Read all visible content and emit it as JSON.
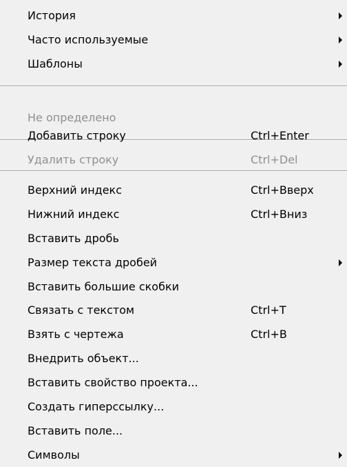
{
  "menu": {
    "items": [
      {
        "label": "История",
        "shortcut": "",
        "submenu": true,
        "disabled": false
      },
      {
        "label": "Часто используемые",
        "shortcut": "",
        "submenu": true,
        "disabled": false
      },
      {
        "label": "Шаблоны",
        "shortcut": "",
        "submenu": true,
        "disabled": false
      },
      {
        "label": "Не определено",
        "shortcut": "",
        "submenu": false,
        "disabled": true
      },
      {
        "label": "Добавить строку",
        "shortcut": "Ctrl+Enter",
        "submenu": false,
        "disabled": false
      },
      {
        "label": "Удалить строку",
        "shortcut": "Ctrl+Del",
        "submenu": false,
        "disabled": true
      },
      {
        "label": "Верхний индекс",
        "shortcut": "Ctrl+Вверх",
        "submenu": false,
        "disabled": false
      },
      {
        "label": "Нижний индекс",
        "shortcut": "Ctrl+Вниз",
        "submenu": false,
        "disabled": false
      },
      {
        "label": "Вставить дробь",
        "shortcut": "",
        "submenu": false,
        "disabled": false
      },
      {
        "label": "Размер текста дробей",
        "shortcut": "",
        "submenu": true,
        "disabled": false
      },
      {
        "label": "Вставить большие скобки",
        "shortcut": "",
        "submenu": false,
        "disabled": false
      },
      {
        "label": "Связать с текстом",
        "shortcut": "Ctrl+T",
        "submenu": false,
        "disabled": false
      },
      {
        "label": "Взять с чертежа",
        "shortcut": "Ctrl+B",
        "submenu": false,
        "disabled": false
      },
      {
        "label": "Внедрить объект...",
        "shortcut": "",
        "submenu": false,
        "disabled": false
      },
      {
        "label": "Вставить свойство проекта...",
        "shortcut": "",
        "submenu": false,
        "disabled": false
      },
      {
        "label": "Создать гиперссылку...",
        "shortcut": "",
        "submenu": false,
        "disabled": false
      },
      {
        "label": "Вставить поле...",
        "shortcut": "",
        "submenu": false,
        "disabled": false
      },
      {
        "label": "Символы",
        "shortcut": "",
        "submenu": true,
        "disabled": false
      }
    ]
  },
  "colors": {
    "menu_background": "#f0f0f0",
    "text": "#000000",
    "disabled_text": "#8f8f8f"
  }
}
